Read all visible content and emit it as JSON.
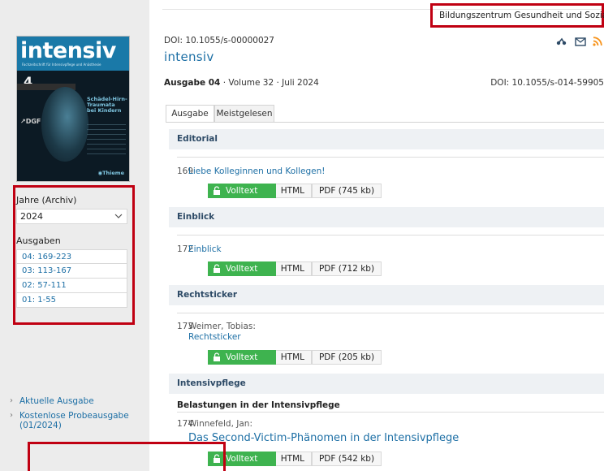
{
  "header": {
    "institution": "Bildungszentrum Gesundheit und Soziales"
  },
  "sidebar": {
    "cover": {
      "title": "intensiv",
      "subtitle": "Fachzeitschrift für Intensivpflege und Anästhesie",
      "issue_number": "4",
      "teaser": "Schädel-Hirn-\nTraumata\nbei Kindern",
      "publisher_left": "DGF",
      "publisher_right": "Thieme"
    },
    "jahre_label": "Jahre (Archiv)",
    "year_selected": "2024",
    "ausgaben_label": "Ausgaben",
    "issues": [
      "04: 169-223",
      "03: 113-167",
      "02: 57-111",
      "01: 1-55"
    ],
    "links": [
      "Aktuelle Ausgabe",
      "Kostenlose Probeausgabe\n(01/2024)"
    ]
  },
  "main": {
    "doi_top": "DOI: 10.1055/s-00000027",
    "journal_title": "intensiv",
    "issue_bold": "Ausgabe 04",
    "issue_rest": " · Volume 32 · Juli 2024",
    "doi_right": "DOI: 10.1055/s-014-59905",
    "tabs": [
      "Ausgabe",
      "Meistgelesen"
    ],
    "buttons": {
      "volltext": "Volltext",
      "html": "HTML"
    },
    "sections": [
      {
        "heading": "Editorial",
        "articles": [
          {
            "page": "169",
            "author": "",
            "title": "Liebe Kolleginnen und Kollegen!",
            "pdf": "PDF (745 kb)"
          }
        ]
      },
      {
        "heading": "Einblick",
        "articles": [
          {
            "page": "172",
            "author": "",
            "title": "Einblick",
            "pdf": "PDF (712 kb)"
          }
        ]
      },
      {
        "heading": "Rechtsticker",
        "articles": [
          {
            "page": "173",
            "author": "Weimer, Tobias:",
            "title": "Rechtsticker",
            "pdf": "PDF (205 kb)"
          }
        ]
      },
      {
        "heading": "Intensivpflege",
        "subheading": "Belastungen in der Intensivpflege",
        "articles": [
          {
            "page": "174",
            "author": "Winnefeld, Jan:",
            "title": "Das Second-Victim-Phänomen in der Intensivpflege",
            "pdf": "PDF (542 kb)"
          }
        ]
      }
    ]
  },
  "colors": {
    "accent_blue": "#1d6fa5",
    "volltext_green": "#3eb34f",
    "highlight_red": "#c00012",
    "sidebar_bg": "#ececec"
  },
  "icons": [
    "share-icon",
    "mail-icon",
    "rss-icon",
    "lock-icon",
    "chevron-down-icon",
    "arrow-right-icon"
  ]
}
